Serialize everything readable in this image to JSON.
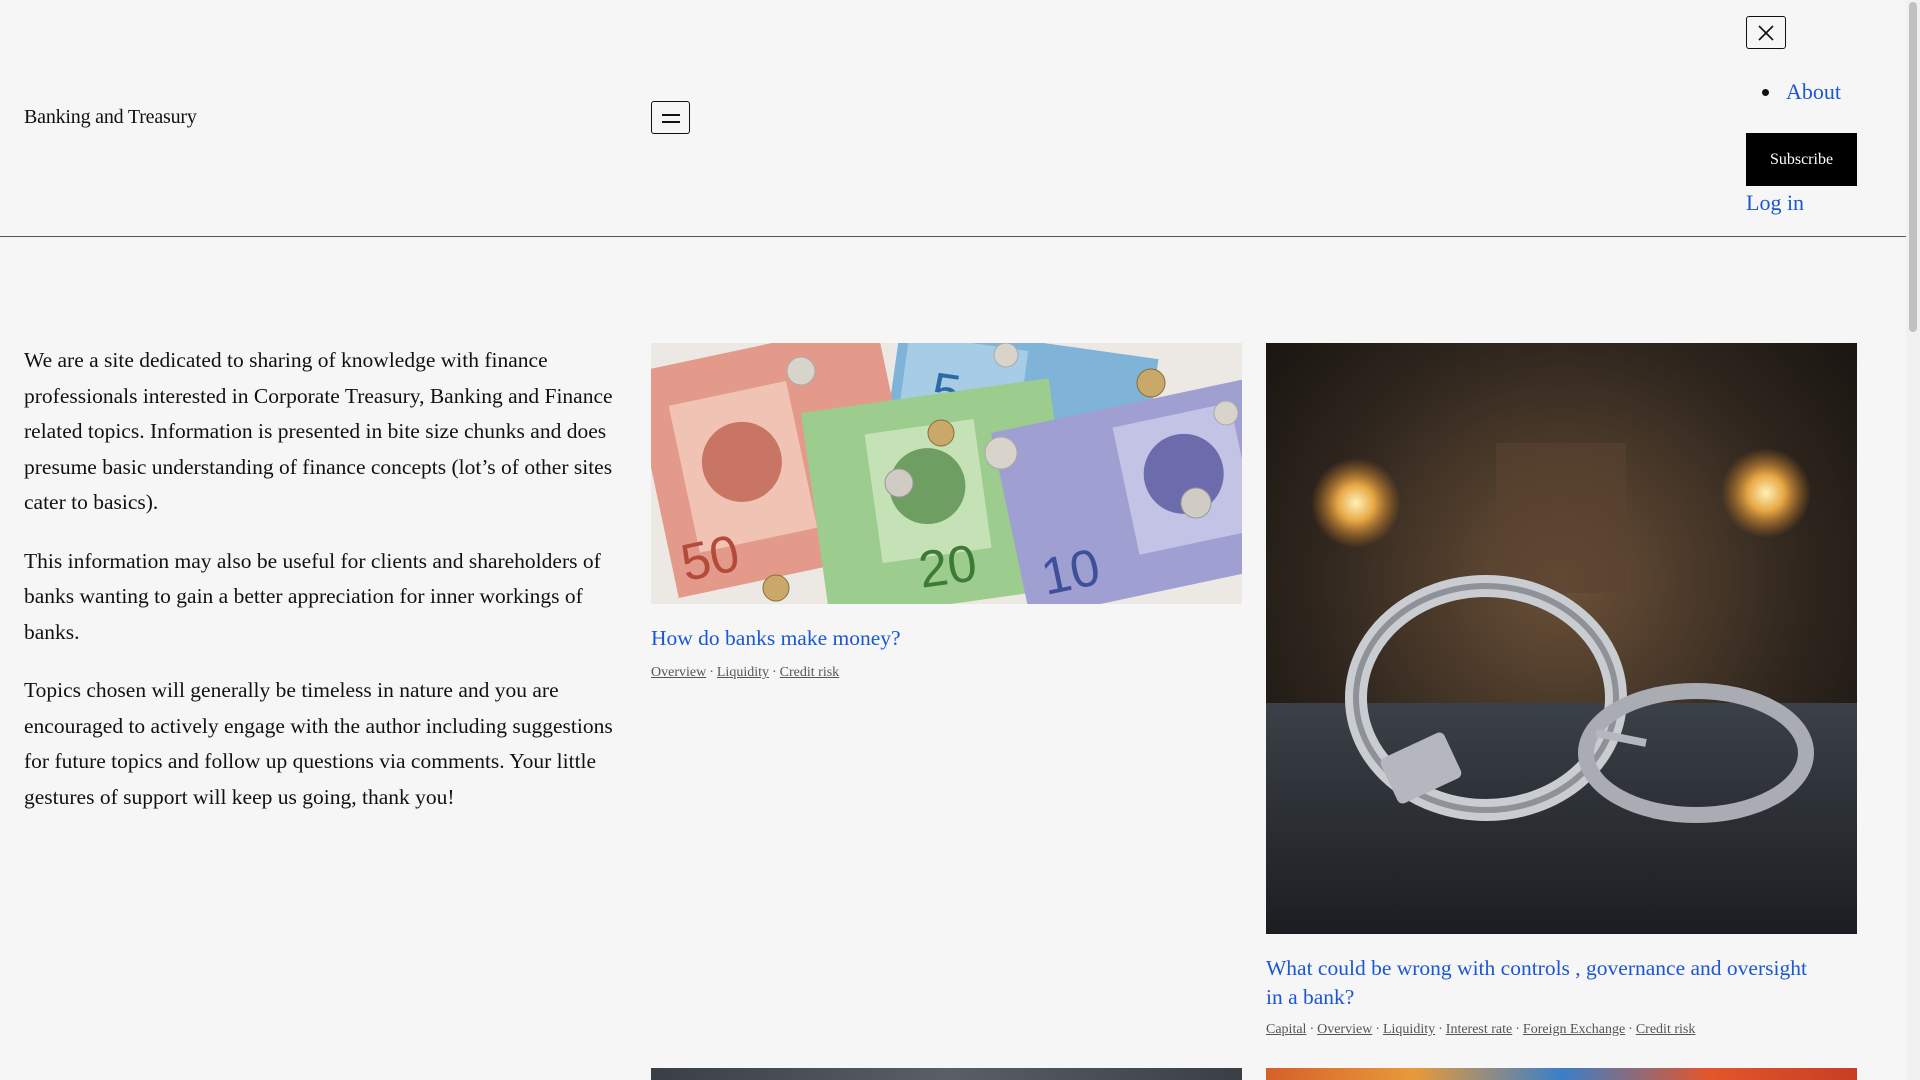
{
  "header": {
    "site_title": "Banking and Treasury",
    "nav": {
      "about_label": "About"
    },
    "subscribe_label": "Subscribe",
    "login_label": "Log in"
  },
  "icons": {
    "menu": "hamburger-icon",
    "close": "close-icon"
  },
  "colors": {
    "link": "#1a57d5",
    "background": "#f6f6f6",
    "button": "#000000"
  },
  "intro": {
    "paragraphs": [
      "We are a site dedicated to sharing of knowledge with finance professionals interested in Corporate Treasury, Banking and Finance related topics. Information is presented in bite size chunks and does presume basic understanding of finance concepts (lot’s of other sites cater to basics).",
      "This information may also be useful for clients and shareholders of banks wanting to gain a better appreciation for inner workings of banks.",
      "Topics chosen will generally be timeless in nature and you are encouraged to actively engage with the author including suggestions for future topics and follow up questions via comments. Your little gestures of support will keep us going, thank you!"
    ]
  },
  "posts": [
    {
      "title": "How do banks make money?",
      "image": "canadian-banknotes-and-coins-image",
      "tags": [
        "Overview",
        "Liquidity",
        "Credit risk"
      ]
    },
    {
      "title": "What could be wrong with controls , governance and oversight in a bank?",
      "image": "handcuffs-image",
      "tags": [
        "Capital",
        "Overview",
        "Liquidity",
        "Interest rate",
        "Foreign Exchange",
        "Credit risk"
      ]
    }
  ]
}
